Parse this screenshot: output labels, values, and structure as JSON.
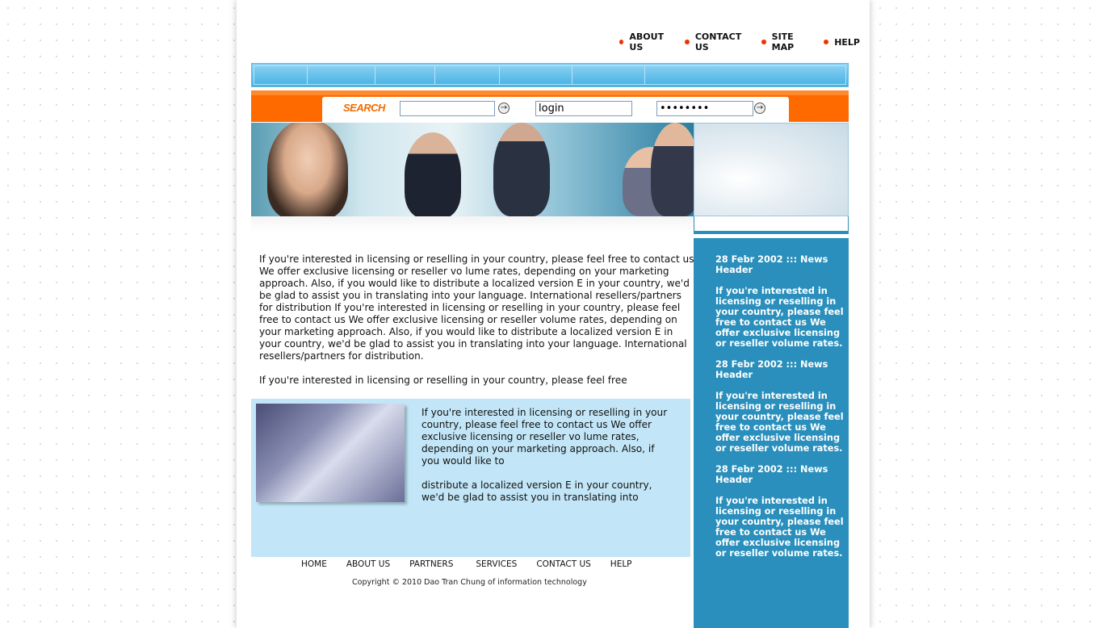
{
  "top_links": [
    "ABOUT US",
    "CONTACT US",
    "SITE MAP",
    "HELP"
  ],
  "search": {
    "label": "SEARCH",
    "value": ""
  },
  "login": {
    "username": "login",
    "password": "••••••••"
  },
  "main": {
    "paragraph1": "If you're interested in licensing or reselling in your country, please feel free to contact us We offer exclusive licensing or reseller vo lume rates, depending on your marketing approach. Also, if you would like to distribute a localized version E in your country, we'd be glad to assist you in translating into your language. International resellers/partners for distribution If you're interested in licensing or reselling in your country, please feel free to contact us We offer exclusive licensing or reseller volume rates, depending on your marketing approach. Also, if you would like to distribute a localized version E in your country, we'd be glad to assist you in translating into your language. International resellers/partners for distribution.",
    "paragraph2": "If you're interested in licensing or reselling in your country, please feel free",
    "box_paragraph1": "If you're interested in licensing or reselling in your country, please feel free to contact us We offer exclusive licensing or reseller vo lume rates, depending on your marketing approach. Also, if you would like to",
    "box_paragraph2": "distribute a localized version E in your country, we'd be glad to assist you in translating into"
  },
  "footer": {
    "nav": [
      "HOME",
      "ABOUT US",
      "PARTNERS",
      "SERVICES",
      "CONTACT US",
      "HELP"
    ],
    "copyright": "Copyright © 2010 Dao Tran Chung of information technology"
  },
  "news": [
    {
      "header": "28 Febr 2002 ::: News Header",
      "body": "If you're interested in licensing or reselling in your country, please feel free to contact us We offer exclusive licensing or reseller volume rates."
    },
    {
      "header": "28 Febr 2002 ::: News Header",
      "body": "If you're interested in licensing or reselling in your country, please feel free to contact us We offer exclusive licensing or reseller volume rates."
    },
    {
      "header": "28 Febr 2002 ::: News Header",
      "body": "If you're interested in licensing or reselling in your country, please feel free to contact us We offer exclusive licensing or reseller volume rates."
    }
  ]
}
